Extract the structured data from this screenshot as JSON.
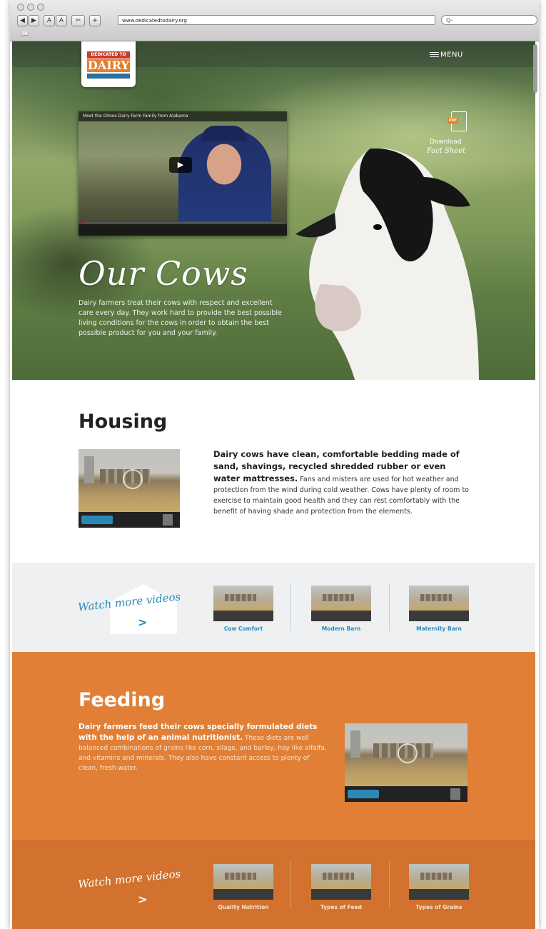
{
  "browser": {
    "url": "www.dedicatedtodairy.org",
    "font_small": "A",
    "font_large": "A",
    "add": "+",
    "search_placeholder": "Q-"
  },
  "header": {
    "logo_line1": "DEDICATED TO",
    "logo_line2": "DAIRY",
    "menu_label": "MENU"
  },
  "hero": {
    "video_title": "Meet the Olmos Dairy Farm Family from Alabama",
    "title": "Our Cows",
    "paragraph": "Dairy farmers treat their cows with respect and excellent care every day. They work hard to provide the best possible living conditions for the cows in order to obtain the best possible product for you and your family.",
    "download_line1": "Download",
    "download_line2": "Fact Sheet",
    "download_badge": "PDF"
  },
  "housing": {
    "title": "Housing",
    "lead": "Dairy cows have clean, comfortable bedding made of sand, shavings, recycled shredded rubber or even water mattresses.",
    "body": " Fans and misters are used for hot weather and protection from the wind during cold weather. Cows have plenty of room to exercise to maintain good health and they can rest comfortably with the benefit of having shade and protection from the elements."
  },
  "housing_more": {
    "label": "Watch more videos",
    "videos": [
      "Cow Comfort",
      "Modern Barn",
      "Maternity Barn"
    ]
  },
  "feeding": {
    "title": "Feeding",
    "lead": "Dairy farmers feed their cows specially formulated diets with the help of an animal nutritionist.",
    "body": " These diets are well balanced combinations of grains like corn, silage, and barley, hay like alfalfa, and vitamins and minerals. They also have constant access to plenty of clean, fresh water."
  },
  "feeding_more": {
    "label": "Watch more videos",
    "videos": [
      "Quality Nutrition",
      "Types of Feed",
      "Types of Grains"
    ]
  },
  "colors": {
    "accent_orange": "#e07f35",
    "accent_blue": "#2a8bb8"
  }
}
